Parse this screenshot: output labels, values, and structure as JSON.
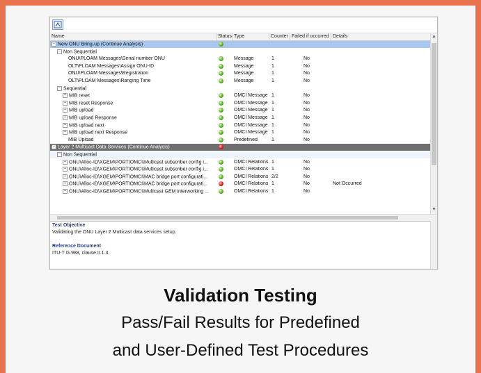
{
  "columns": {
    "name": "Name",
    "status": "Status",
    "type": "Type",
    "counter": "Counter",
    "failed": "Failed if occurred",
    "details": "Details"
  },
  "rows": [
    {
      "name": "New ONU Bring-up (Continue Analysis)",
      "indent": 0,
      "status": "ok",
      "type": "",
      "counter": "",
      "failed": "",
      "details": "",
      "style": "hl",
      "exp": "−"
    },
    {
      "name": "Non Sequential",
      "indent": 1,
      "status": "",
      "type": "",
      "counter": "",
      "failed": "",
      "details": "",
      "style": "",
      "exp": "−"
    },
    {
      "name": "ONU\\PLOAM Messages\\Serial number ONU",
      "indent": 3,
      "status": "ok",
      "type": "Message",
      "counter": "1",
      "failed": "No",
      "details": "",
      "style": "",
      "exp": ""
    },
    {
      "name": "OLT\\PLOAM Messages\\Assign ONU-ID",
      "indent": 3,
      "status": "ok",
      "type": "Message",
      "counter": "1",
      "failed": "No",
      "details": "",
      "style": "",
      "exp": ""
    },
    {
      "name": "ONU\\PLOAM Messages\\Registration",
      "indent": 3,
      "status": "ok",
      "type": "Message",
      "counter": "1",
      "failed": "No",
      "details": "",
      "style": "",
      "exp": ""
    },
    {
      "name": "OLT\\PLOAM Messages\\Ranging Time",
      "indent": 3,
      "status": "ok",
      "type": "Message",
      "counter": "1",
      "failed": "No",
      "details": "",
      "style": "",
      "exp": ""
    },
    {
      "name": "Sequential",
      "indent": 1,
      "status": "",
      "type": "",
      "counter": "",
      "failed": "",
      "details": "",
      "style": "",
      "exp": "−"
    },
    {
      "name": "MIB reset",
      "indent": 2,
      "status": "ok",
      "type": "OMCI Message",
      "counter": "1",
      "failed": "No",
      "details": "",
      "style": "",
      "exp": "+"
    },
    {
      "name": "MIB reset Response",
      "indent": 2,
      "status": "ok",
      "type": "OMCI Message",
      "counter": "1",
      "failed": "No",
      "details": "",
      "style": "",
      "exp": "+"
    },
    {
      "name": "MIB upload",
      "indent": 2,
      "status": "ok",
      "type": "OMCI Message",
      "counter": "1",
      "failed": "No",
      "details": "",
      "style": "",
      "exp": "+"
    },
    {
      "name": "MIB upload Response",
      "indent": 2,
      "status": "ok",
      "type": "OMCI Message",
      "counter": "1",
      "failed": "No",
      "details": "",
      "style": "",
      "exp": "+"
    },
    {
      "name": "MIB upload next",
      "indent": 2,
      "status": "ok",
      "type": "OMCI Message",
      "counter": "1",
      "failed": "No",
      "details": "",
      "style": "",
      "exp": "+"
    },
    {
      "name": "MIB upload next Response",
      "indent": 2,
      "status": "ok",
      "type": "OMCI Message",
      "counter": "1",
      "failed": "No",
      "details": "",
      "style": "",
      "exp": "+"
    },
    {
      "name": "MIB Upload",
      "indent": 3,
      "status": "ok",
      "type": "Predefined",
      "counter": "1",
      "failed": "No",
      "details": "",
      "style": "",
      "exp": ""
    },
    {
      "name": "Layer 2 Multicast Data Services (Continue Analysis)",
      "indent": 0,
      "status": "err",
      "type": "",
      "counter": "",
      "failed": "",
      "details": "",
      "style": "dark",
      "exp": "−"
    },
    {
      "name": "Non Sequential",
      "indent": 1,
      "status": "",
      "type": "",
      "counter": "",
      "failed": "",
      "details": "",
      "style": "sub",
      "exp": "−"
    },
    {
      "name": "ONU\\Alloc-ID\\XGEM\\PORT\\OMCI\\Multicast subscriber config i...",
      "indent": 2,
      "status": "ok",
      "type": "OMCI Relations",
      "counter": "1",
      "failed": "No",
      "details": "",
      "style": "",
      "exp": "+"
    },
    {
      "name": "ONU\\Alloc-ID\\XGEM\\PORT\\OMCI\\Multicast subscriber config i...",
      "indent": 2,
      "status": "ok",
      "type": "OMCI Relations",
      "counter": "1",
      "failed": "No",
      "details": "",
      "style": "",
      "exp": "+"
    },
    {
      "name": "ONU\\Alloc-ID\\XGEM\\PORT\\OMCI\\MAC bridge port configurati...",
      "indent": 2,
      "status": "ok",
      "type": "OMCI Relations",
      "counter": "2/2",
      "failed": "No",
      "details": "",
      "style": "",
      "exp": "+"
    },
    {
      "name": "ONU\\Alloc-ID\\XGEM\\PORT\\OMCI\\MAC bridge port configurati...",
      "indent": 2,
      "status": "err",
      "type": "OMCI Relations",
      "counter": "1",
      "failed": "No",
      "details": "Not Occurred",
      "style": "",
      "exp": "+"
    },
    {
      "name": "ONU\\Alloc-ID\\XGEM\\PORT\\OMCI\\Multicast GEM interworking ...",
      "indent": 2,
      "status": "ok",
      "type": "OMCI Relations",
      "counter": "1",
      "failed": "No",
      "details": "",
      "style": "",
      "exp": "+"
    }
  ],
  "pane": {
    "objective_title": "Test Objective",
    "objective_text": "Validating the ONU Layer 2 Multicast data services setup.",
    "reference_title": "Reference Document",
    "reference_text": "ITU-T G.988, clause II.1.3."
  },
  "caption": {
    "title": "Validation Testing",
    "line1": "Pass/Fail Results for Predefined",
    "line2": "and User-Defined Test Procedures"
  },
  "colors": {
    "border": "#E8734E",
    "highlight": "#a9c7ee",
    "dark_row": "#6e6e6e"
  }
}
